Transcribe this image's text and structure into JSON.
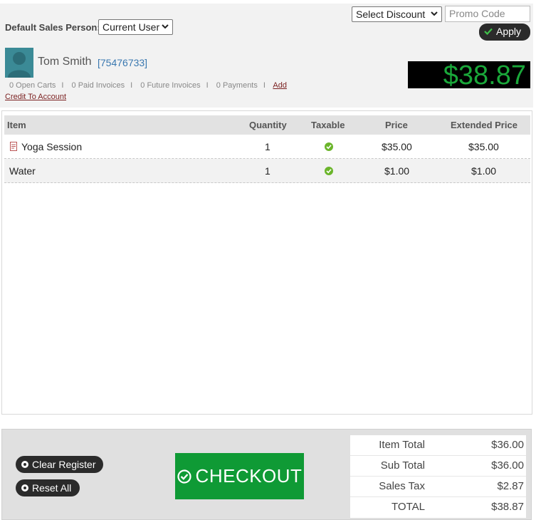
{
  "header": {
    "default_sales_person_label": "Default Sales Person:",
    "sales_person_select": "Current User",
    "discount_select": "Select Discount",
    "promo_placeholder": "Promo Code",
    "apply_label": "Apply"
  },
  "customer": {
    "name": "Tom Smith",
    "id": "[75476733]",
    "stats": [
      "0 Open Carts",
      "0 Paid Invoices",
      "0 Future Invoices",
      "0 Payments"
    ],
    "add_link": "Add",
    "credit_link": "Credit To Account"
  },
  "total_display": "$38.87",
  "table": {
    "headers": [
      "Item",
      "Quantity",
      "Taxable",
      "Price",
      "Extended Price"
    ],
    "rows": [
      {
        "item": "Yoga Session",
        "quantity": "1",
        "taxable": true,
        "price": "$35.00",
        "extended": "$35.00",
        "icon": "document-icon"
      },
      {
        "item": "Water",
        "quantity": "1",
        "taxable": true,
        "price": "$1.00",
        "extended": "$1.00"
      }
    ]
  },
  "actions": {
    "clear_register": "Clear Register",
    "reset_all": "Reset All",
    "checkout": "CHECKOUT"
  },
  "totals": [
    {
      "label": "Item Total",
      "value": "$36.00"
    },
    {
      "label": "Sub Total",
      "value": "$36.00"
    },
    {
      "label": "Sales Tax",
      "value": "$2.87"
    },
    {
      "label": "TOTAL",
      "value": "$38.87"
    }
  ],
  "colors": {
    "checkout_green": "#0f9a35",
    "display_green": "#1aa83a",
    "link_red": "#7a1f1f",
    "id_blue": "#3a78b0"
  }
}
